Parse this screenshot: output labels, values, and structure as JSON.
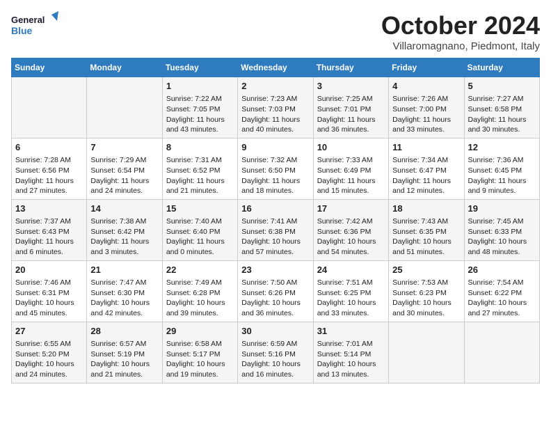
{
  "header": {
    "logo_line1": "General",
    "logo_line2": "Blue",
    "month_title": "October 2024",
    "subtitle": "Villaromagnano, Piedmont, Italy"
  },
  "days_of_week": [
    "Sunday",
    "Monday",
    "Tuesday",
    "Wednesday",
    "Thursday",
    "Friday",
    "Saturday"
  ],
  "weeks": [
    [
      {
        "day": "",
        "info": ""
      },
      {
        "day": "",
        "info": ""
      },
      {
        "day": "1",
        "info": "Sunrise: 7:22 AM\nSunset: 7:05 PM\nDaylight: 11 hours and 43 minutes."
      },
      {
        "day": "2",
        "info": "Sunrise: 7:23 AM\nSunset: 7:03 PM\nDaylight: 11 hours and 40 minutes."
      },
      {
        "day": "3",
        "info": "Sunrise: 7:25 AM\nSunset: 7:01 PM\nDaylight: 11 hours and 36 minutes."
      },
      {
        "day": "4",
        "info": "Sunrise: 7:26 AM\nSunset: 7:00 PM\nDaylight: 11 hours and 33 minutes."
      },
      {
        "day": "5",
        "info": "Sunrise: 7:27 AM\nSunset: 6:58 PM\nDaylight: 11 hours and 30 minutes."
      }
    ],
    [
      {
        "day": "6",
        "info": "Sunrise: 7:28 AM\nSunset: 6:56 PM\nDaylight: 11 hours and 27 minutes."
      },
      {
        "day": "7",
        "info": "Sunrise: 7:29 AM\nSunset: 6:54 PM\nDaylight: 11 hours and 24 minutes."
      },
      {
        "day": "8",
        "info": "Sunrise: 7:31 AM\nSunset: 6:52 PM\nDaylight: 11 hours and 21 minutes."
      },
      {
        "day": "9",
        "info": "Sunrise: 7:32 AM\nSunset: 6:50 PM\nDaylight: 11 hours and 18 minutes."
      },
      {
        "day": "10",
        "info": "Sunrise: 7:33 AM\nSunset: 6:49 PM\nDaylight: 11 hours and 15 minutes."
      },
      {
        "day": "11",
        "info": "Sunrise: 7:34 AM\nSunset: 6:47 PM\nDaylight: 11 hours and 12 minutes."
      },
      {
        "day": "12",
        "info": "Sunrise: 7:36 AM\nSunset: 6:45 PM\nDaylight: 11 hours and 9 minutes."
      }
    ],
    [
      {
        "day": "13",
        "info": "Sunrise: 7:37 AM\nSunset: 6:43 PM\nDaylight: 11 hours and 6 minutes."
      },
      {
        "day": "14",
        "info": "Sunrise: 7:38 AM\nSunset: 6:42 PM\nDaylight: 11 hours and 3 minutes."
      },
      {
        "day": "15",
        "info": "Sunrise: 7:40 AM\nSunset: 6:40 PM\nDaylight: 11 hours and 0 minutes."
      },
      {
        "day": "16",
        "info": "Sunrise: 7:41 AM\nSunset: 6:38 PM\nDaylight: 10 hours and 57 minutes."
      },
      {
        "day": "17",
        "info": "Sunrise: 7:42 AM\nSunset: 6:36 PM\nDaylight: 10 hours and 54 minutes."
      },
      {
        "day": "18",
        "info": "Sunrise: 7:43 AM\nSunset: 6:35 PM\nDaylight: 10 hours and 51 minutes."
      },
      {
        "day": "19",
        "info": "Sunrise: 7:45 AM\nSunset: 6:33 PM\nDaylight: 10 hours and 48 minutes."
      }
    ],
    [
      {
        "day": "20",
        "info": "Sunrise: 7:46 AM\nSunset: 6:31 PM\nDaylight: 10 hours and 45 minutes."
      },
      {
        "day": "21",
        "info": "Sunrise: 7:47 AM\nSunset: 6:30 PM\nDaylight: 10 hours and 42 minutes."
      },
      {
        "day": "22",
        "info": "Sunrise: 7:49 AM\nSunset: 6:28 PM\nDaylight: 10 hours and 39 minutes."
      },
      {
        "day": "23",
        "info": "Sunrise: 7:50 AM\nSunset: 6:26 PM\nDaylight: 10 hours and 36 minutes."
      },
      {
        "day": "24",
        "info": "Sunrise: 7:51 AM\nSunset: 6:25 PM\nDaylight: 10 hours and 33 minutes."
      },
      {
        "day": "25",
        "info": "Sunrise: 7:53 AM\nSunset: 6:23 PM\nDaylight: 10 hours and 30 minutes."
      },
      {
        "day": "26",
        "info": "Sunrise: 7:54 AM\nSunset: 6:22 PM\nDaylight: 10 hours and 27 minutes."
      }
    ],
    [
      {
        "day": "27",
        "info": "Sunrise: 6:55 AM\nSunset: 5:20 PM\nDaylight: 10 hours and 24 minutes."
      },
      {
        "day": "28",
        "info": "Sunrise: 6:57 AM\nSunset: 5:19 PM\nDaylight: 10 hours and 21 minutes."
      },
      {
        "day": "29",
        "info": "Sunrise: 6:58 AM\nSunset: 5:17 PM\nDaylight: 10 hours and 19 minutes."
      },
      {
        "day": "30",
        "info": "Sunrise: 6:59 AM\nSunset: 5:16 PM\nDaylight: 10 hours and 16 minutes."
      },
      {
        "day": "31",
        "info": "Sunrise: 7:01 AM\nSunset: 5:14 PM\nDaylight: 10 hours and 13 minutes."
      },
      {
        "day": "",
        "info": ""
      },
      {
        "day": "",
        "info": ""
      }
    ]
  ]
}
